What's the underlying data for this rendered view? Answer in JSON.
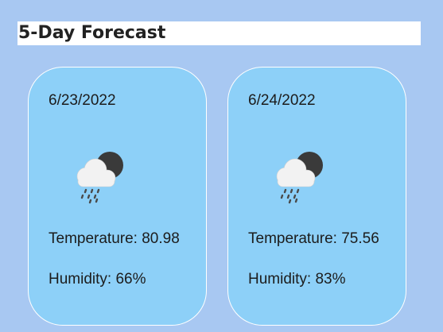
{
  "header": {
    "title": "5-Day Forecast"
  },
  "forecast": [
    {
      "date": "6/23/2022",
      "icon": "night-rain-cloud-icon",
      "temperature": "Temperature: 80.98",
      "humidity": "Humidity: 66%"
    },
    {
      "date": "6/24/2022",
      "icon": "night-rain-cloud-icon",
      "temperature": "Temperature: 75.56",
      "humidity": "Humidity: 83%"
    }
  ],
  "colors": {
    "background": "#a8c8f2",
    "card": "#8dd0f8",
    "card_border": "#ffffff",
    "header_background": "#ffffff",
    "moon": "#3a3a3a",
    "cloud": "#f2f2f2",
    "rain": "#4a4a4a"
  }
}
